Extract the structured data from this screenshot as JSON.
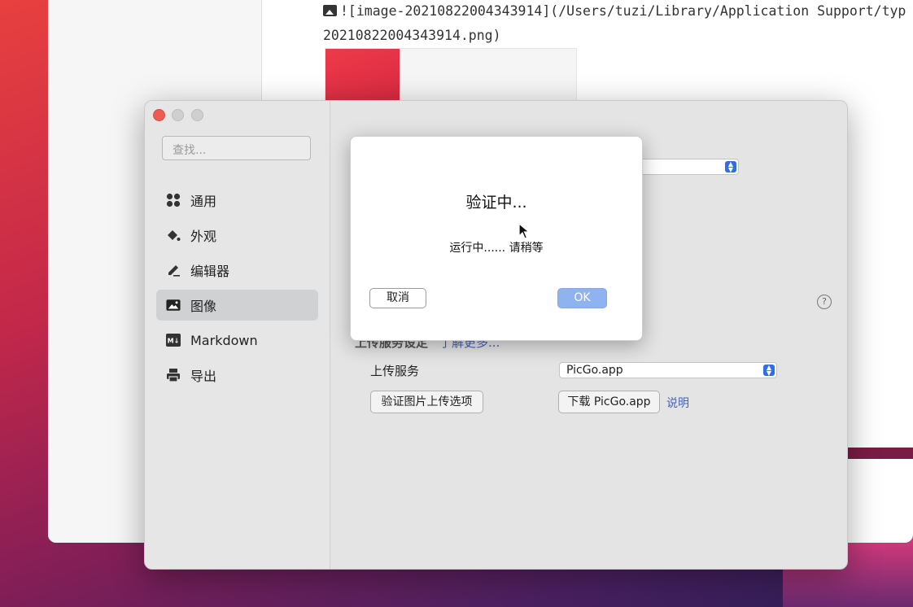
{
  "editor": {
    "image_markdown_line1": "![image-20210822004343914](/Users/tuzi/Library/Application Support/typ",
    "image_markdown_line2": "20210822004343914.png)"
  },
  "prefs": {
    "search_placeholder": "查找...",
    "nav": [
      {
        "label": "通用",
        "icon": "grid-icon"
      },
      {
        "label": "外观",
        "icon": "paint-bucket-icon"
      },
      {
        "label": "编辑器",
        "icon": "pencil-icon"
      },
      {
        "label": "图像",
        "icon": "image-icon",
        "active": true
      },
      {
        "label": "Markdown",
        "icon": "markdown-icon"
      },
      {
        "label": "导出",
        "icon": "printer-icon"
      }
    ],
    "upload": {
      "section_title": "上传服务设定",
      "learn_more": "了解更多...",
      "service_label": "上传服务",
      "service_value": "PicGo.app",
      "verify_button": "验证图片上传选项",
      "download_button": "下载 PicGo.app",
      "help_link": "说明"
    },
    "help_glyph": "?"
  },
  "dialog": {
    "title": "验证中...",
    "message": "运行中...... 请稍等",
    "cancel_label": "取消",
    "ok_label": "OK"
  },
  "colors": {
    "accent_blue": "#2f6ee8",
    "ok_button": "#8fb3f0",
    "close_red": "#ee5b53"
  }
}
